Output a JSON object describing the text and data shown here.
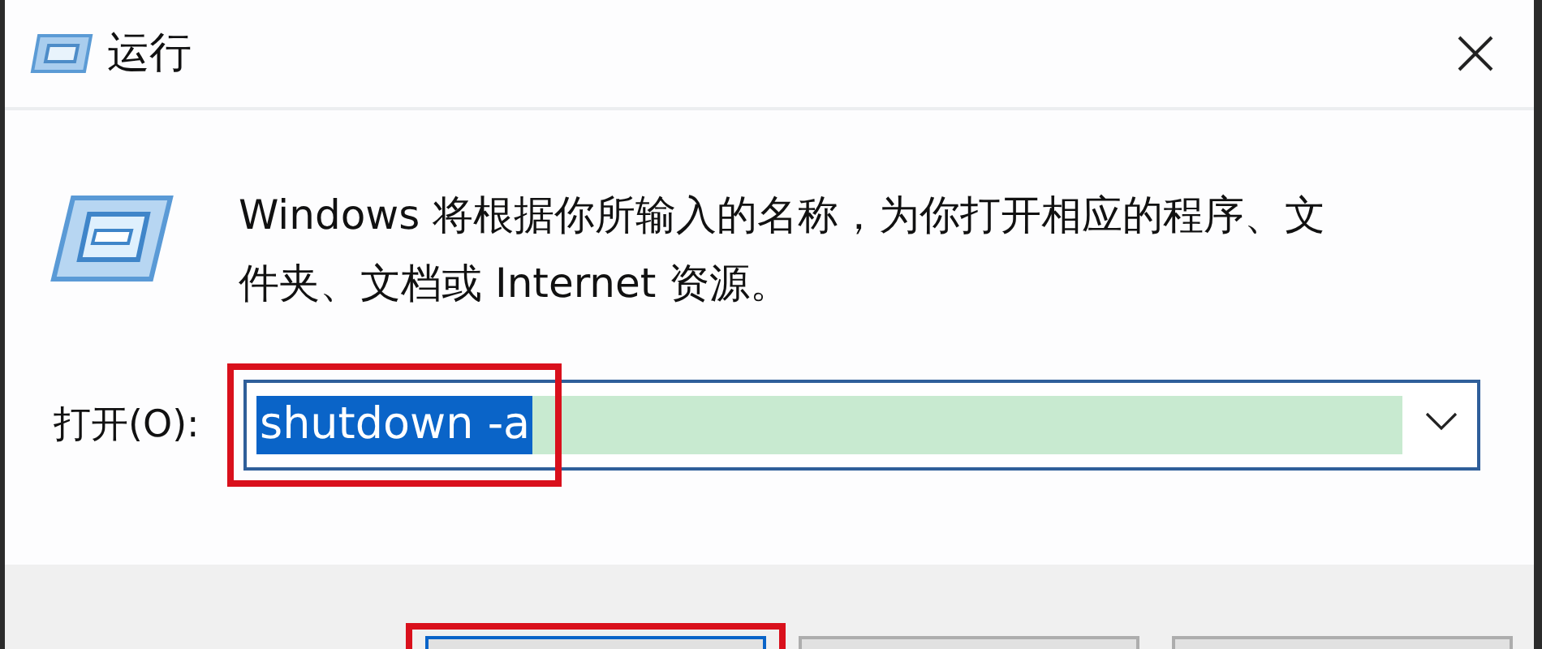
{
  "window": {
    "title": "运行"
  },
  "message": "Windows 将根据你所输入的名称，为你打开相应的程序、文件夹、文档或 Internet 资源。",
  "open_field": {
    "label": "打开(O):",
    "value": "shutdown -a",
    "text_selected": true,
    "highlighted": true,
    "annotated": true
  },
  "buttons": [
    {
      "default": true,
      "annotated": true
    },
    {
      "default": false,
      "annotated": false
    },
    {
      "default": false,
      "annotated": false
    }
  ]
}
